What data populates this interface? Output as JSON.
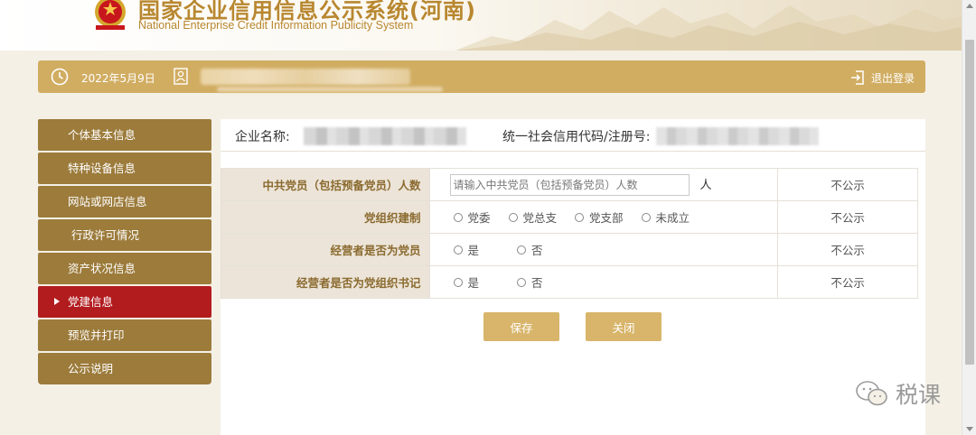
{
  "header": {
    "title": "国家企业信用信息公示系统(河南)",
    "subtitle": "National Enterprise Credit Information Publicity System"
  },
  "topbar": {
    "date": "2022年5月9日",
    "logout_label": "退出登录"
  },
  "sidebar": {
    "items": [
      {
        "label": "个体基本信息",
        "active": false
      },
      {
        "label": "特种设备信息",
        "active": false
      },
      {
        "label": "网站或网店信息",
        "active": false
      },
      {
        "label": "行政许可情况",
        "active": false
      },
      {
        "label": "资产状况信息",
        "active": false
      },
      {
        "label": "党建信息",
        "active": true
      },
      {
        "label": "预览并打印",
        "active": false
      },
      {
        "label": "公示说明",
        "active": false
      }
    ]
  },
  "company": {
    "name_label": "企业名称:",
    "credit_label": "统一社会信用代码/注册号:"
  },
  "form": {
    "rows": [
      {
        "label": "中共党员（包括预备党员）人数",
        "placeholder": "请输入中共党员（包括预备党员）人数",
        "unit": "人",
        "publicity": "不公示"
      },
      {
        "label": "党组织建制",
        "options": [
          "党委",
          "党总支",
          "党支部",
          "未成立"
        ],
        "publicity": "不公示"
      },
      {
        "label": "经营者是否为党员",
        "options": [
          "是",
          "否"
        ],
        "publicity": "不公示"
      },
      {
        "label": "经营者是否为党组织书记",
        "options": [
          "是",
          "否"
        ],
        "publicity": "不公示"
      }
    ]
  },
  "actions": {
    "save_label": "保存",
    "close_label": "关闭"
  },
  "watermark": {
    "text": "税课"
  },
  "colors": {
    "gold": "#d1ad62",
    "sidebar_brown": "#9c7b3b",
    "active_red": "#b21c1f",
    "label_bg": "#ece4d8",
    "button_gold": "#d8b56a"
  }
}
